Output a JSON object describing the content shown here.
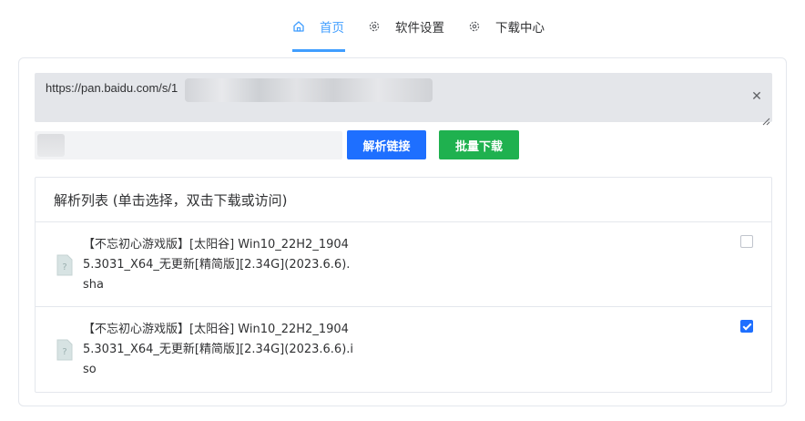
{
  "nav": {
    "tabs": [
      {
        "label": "首页",
        "icon": "home-icon",
        "active": true
      },
      {
        "label": "软件设置",
        "icon": "gear-icon",
        "active": false
      },
      {
        "label": "下载中心",
        "icon": "gear-icon",
        "active": false
      }
    ]
  },
  "form": {
    "url_value": "https://pan.baidu.com/s/1",
    "parse_button": "解析链接",
    "batch_button": "批量下载"
  },
  "list": {
    "title": "解析列表 (单击选择，双击下载或访问)",
    "items": [
      {
        "name": "【不忘初心游戏版】[太阳谷] Win10_22H2_19045.3031_X64_无更新[精简版][2.34G](2023.6.6).sha",
        "checked": false
      },
      {
        "name": "【不忘初心游戏版】[太阳谷] Win10_22H2_19045.3031_X64_无更新[精简版][2.34G](2023.6.6).iso",
        "checked": true
      }
    ]
  },
  "colors": {
    "accent": "#409eff",
    "primary_button": "#1e6fff",
    "success_button": "#1fb14f"
  }
}
